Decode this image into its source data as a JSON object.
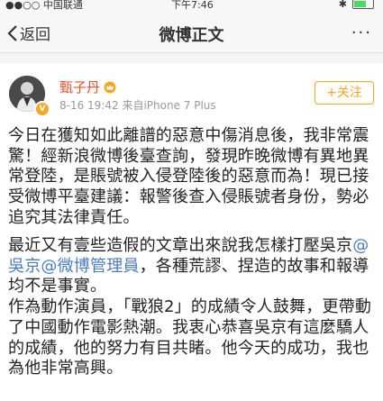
{
  "status": {
    "carrier": "●●○○ 中国联通 ",
    "time": "下午7:46"
  },
  "nav": {
    "back_label": "返回",
    "title": "微博正文",
    "more_label": "···"
  },
  "post": {
    "author": "甄子丹",
    "time": "8-16 19:42",
    "source": "来自iPhone 7 Plus",
    "follow_label": "+关注",
    "para1": "今日在獲知如此離譜的惡意中傷消息後，我非常震驚！經新浪微博後臺查詢，發現昨晚微博有異地異常登陸，是賬號被入侵登陸後的惡意而為！現已接受微博平臺建議：報警後查入侵賬號者身份，勢必追究其法律責任。",
    "para2_a": "最近又有壹些造假的文章出來說我怎樣打壓吳京",
    "mention1": "@吳京",
    "mention2": "@微博管理員",
    "para2_b": "，各種荒謬、捏造的故事和報導均不是事實。",
    "para2_c": "作為動作演員，「戰狼2」的成績令人鼓舞，更帶動了中國動作電影熱潮。我衷心恭喜吳京有這麼驕人的成績，他的努力有目共睹。他今天的成功，我也為他非常高興。"
  }
}
